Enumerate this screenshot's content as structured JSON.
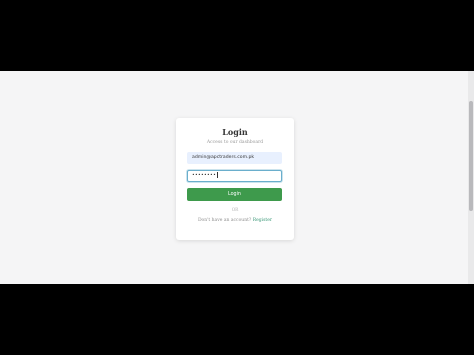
{
  "login": {
    "title": "Login",
    "subtitle": "Access to our dashboard",
    "email_value": "admin@apctraders.com.pk",
    "password_mask": "••••••••",
    "button_label": "Login",
    "or_text": "OR",
    "no_account_text": "Don't have an account?",
    "register_label": "Register"
  },
  "colors": {
    "page_background": "#f5f5f6",
    "button": "#3e9a4c",
    "focus_border": "#6aaecc",
    "autofill_background": "#e8f0fe",
    "link": "#3e9a7a"
  }
}
